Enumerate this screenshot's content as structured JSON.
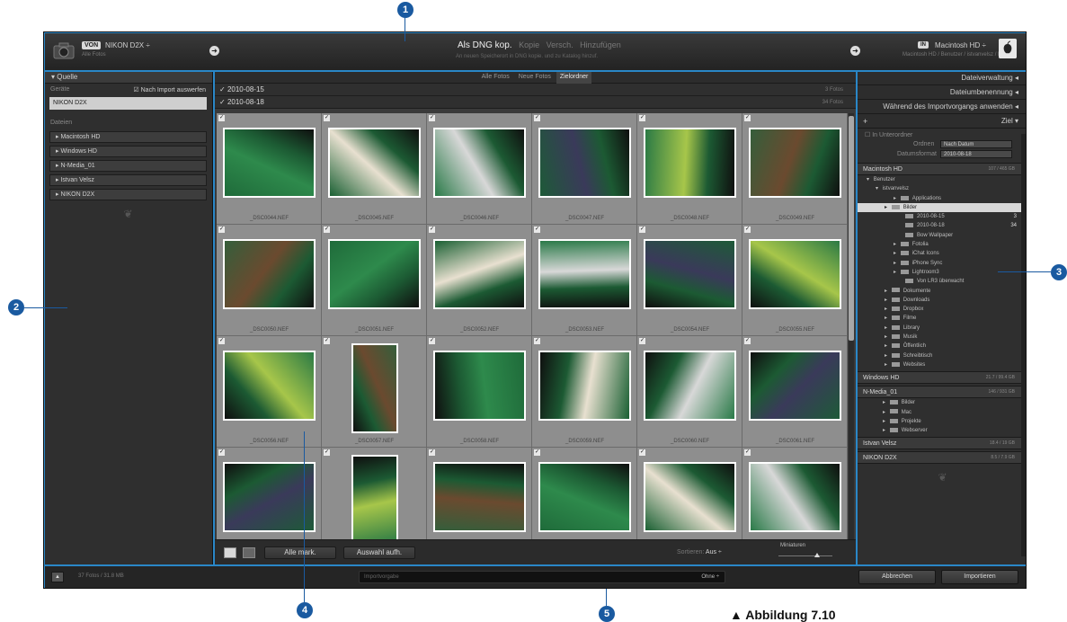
{
  "header": {
    "source_badge": "VON",
    "source_name": "NIKON D2X ÷",
    "source_sub": "Alle Fotos",
    "modes": [
      "Als DNG kop.",
      "Kopie",
      "Versch.",
      "Hinzufügen"
    ],
    "mode_description": "An neuen Speicherort in DNG kopie. und zu Katalog hinzuf.",
    "dest_badge": "IN",
    "dest_name": "Macintosh HD ÷",
    "dest_sub": "Macintosh HD / Benutzer / istvanvelsz / Bilder"
  },
  "source_panel": {
    "title": "Quelle",
    "devices_label": "Geräte",
    "eject_label": "Nach Import auswerfen",
    "selected_device": "NIKON D2X",
    "files_label": "Dateien",
    "volumes": [
      "Macintosh HD",
      "Windows HD",
      "N-Media_01",
      "Istvan Velsz",
      "NIKON D2X"
    ]
  },
  "grid": {
    "filters": [
      "Alle Fotos",
      "Neue Fotos",
      "Zielordner"
    ],
    "active_filter": "Zielordner",
    "dates": [
      {
        "date": "2010-08-15",
        "count": "3 Fotos"
      },
      {
        "date": "2010-08-18",
        "count": "34 Fotos"
      }
    ],
    "filenames": [
      "_DSC0044.NEF",
      "_DSC0045.NEF",
      "_DSC0046.NEF",
      "_DSC0047.NEF",
      "_DSC0048.NEF",
      "_DSC0049.NEF",
      "_DSC0050.NEF",
      "_DSC0051.NEF",
      "_DSC0052.NEF",
      "_DSC0053.NEF",
      "_DSC0054.NEF",
      "_DSC0055.NEF",
      "_DSC0056.NEF",
      "_DSC0057.NEF",
      "_DSC0058.NEF",
      "_DSC0059.NEF",
      "_DSC0060.NEF",
      "_DSC0061.NEF",
      "",
      "",
      "",
      "",
      "",
      ""
    ],
    "check_all_label": "Alle mark.",
    "uncheck_all_label": "Auswahl aufh.",
    "sort_label": "Sortieren:",
    "sort_value": "Aus ÷",
    "thumbnail_label": "Miniaturen"
  },
  "dest_panel": {
    "sections": [
      "Dateiverwaltung",
      "Dateiumbenennung",
      "Während des Importvorgangs anwenden"
    ],
    "target_title": "Ziel",
    "subfolder_label": "In Unterordner",
    "organize_label": "Ordnen",
    "organize_value": "Nach Datum",
    "date_format_label": "Datumsformat",
    "date_format_value": "2010-08-18",
    "volume_main": {
      "name": "Macintosh HD",
      "size": "107 / 465 GB"
    },
    "tree": [
      {
        "label": "Benutzer",
        "indent": 0,
        "folder": false
      },
      {
        "label": "istvanvelsz",
        "indent": 1,
        "folder": false
      },
      {
        "label": "Applications",
        "indent": 3,
        "folder": true
      },
      {
        "label": "Bilder",
        "indent": 2,
        "folder": true,
        "selected": true
      },
      {
        "label": "2010-08-15",
        "indent": 4,
        "folder": true,
        "count": "3"
      },
      {
        "label": "2010-08-18",
        "indent": 4,
        "folder": true,
        "count": "34"
      },
      {
        "label": "Bow Wallpaper",
        "indent": 4,
        "folder": true
      },
      {
        "label": "Fotolia",
        "indent": 3,
        "folder": true
      },
      {
        "label": "iChat Icons",
        "indent": 3,
        "folder": true
      },
      {
        "label": "iPhone Sync",
        "indent": 3,
        "folder": true
      },
      {
        "label": "Lightroom3",
        "indent": 3,
        "folder": true
      },
      {
        "label": "Von LR3 überwacht",
        "indent": 4,
        "folder": true
      },
      {
        "label": "Dokumente",
        "indent": 2,
        "folder": true
      },
      {
        "label": "Downloads",
        "indent": 2,
        "folder": true
      },
      {
        "label": "Dropbox",
        "indent": 2,
        "folder": true
      },
      {
        "label": "Filme",
        "indent": 2,
        "folder": true
      },
      {
        "label": "Library",
        "indent": 2,
        "folder": true
      },
      {
        "label": "Musik",
        "indent": 2,
        "folder": true
      },
      {
        "label": "Öffentlich",
        "indent": 2,
        "folder": true
      },
      {
        "label": "Schreibtisch",
        "indent": 2,
        "folder": true
      },
      {
        "label": "Websites",
        "indent": 2,
        "folder": true
      }
    ],
    "volume_windows": {
      "name": "Windows HD",
      "size": "21.7 / 99.4 GB"
    },
    "volume_nmedia": {
      "name": "N-Media_01",
      "size": "146 / 931 GB"
    },
    "nmedia_tree": [
      "Bilder",
      "Mac",
      "Projekte",
      "Webserver"
    ],
    "volume_istvan": {
      "name": "Istvan Velsz",
      "size": "18.4 / 19 GB"
    },
    "volume_nikon": {
      "name": "NIKON D2X",
      "size": "8.5 / 7.9 GB"
    }
  },
  "statusbar": {
    "info": "37 Fotos / 31.8 MB",
    "preset_label": "Importvorgabe",
    "preset_value": "Ohne ÷",
    "cancel_label": "Abbrechen",
    "import_label": "Importieren"
  },
  "callouts": [
    "1",
    "2",
    "3",
    "4",
    "5"
  ],
  "caption": "▲ Abbildung 7.10"
}
